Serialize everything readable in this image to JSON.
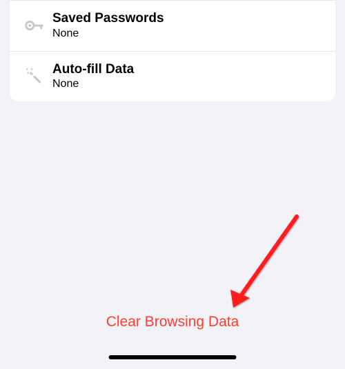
{
  "rows": [
    {
      "title": "Saved Passwords",
      "subtitle": "None"
    },
    {
      "title": "Auto-fill Data",
      "subtitle": "None"
    }
  ],
  "clear_button_label": "Clear Browsing Data",
  "colors": {
    "destructive": "#ff3b30",
    "icon": "#c7c7cc"
  }
}
